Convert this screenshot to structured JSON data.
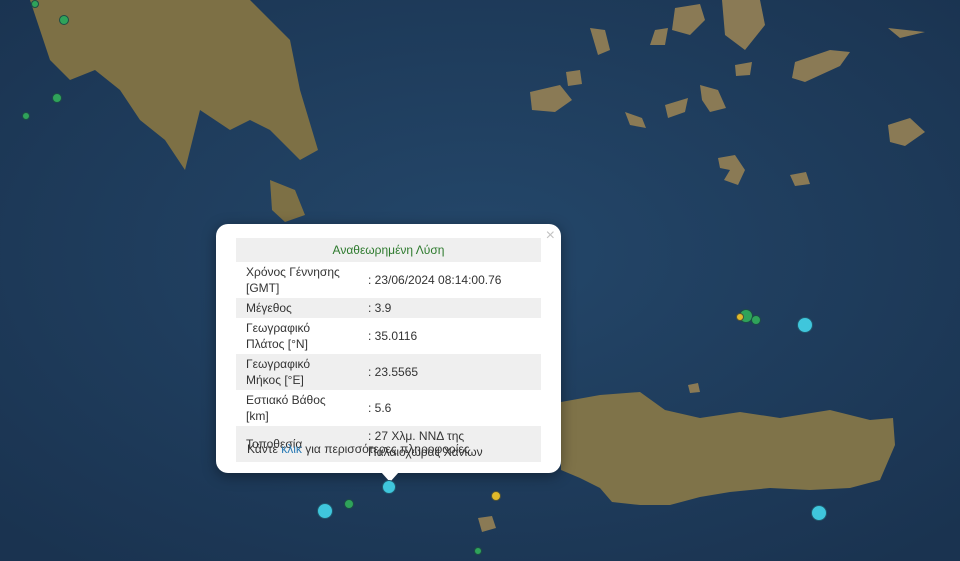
{
  "popup": {
    "title": "Αναθεωρημένη Λύση",
    "close_label": "×",
    "rows": [
      {
        "label": "Χρόνος Γέννησης [GMT]",
        "value": ": 23/06/2024 08:14:00.76"
      },
      {
        "label": "Μέγεθος",
        "value": ": 3.9"
      },
      {
        "label": "Γεωγραφικό Πλάτος [°N]",
        "value": ": 35.0116"
      },
      {
        "label": "Γεωγραφικό Μήκος [°E]",
        "value": ": 23.5565"
      },
      {
        "label": "Εστιακό Βάθος [km]",
        "value": ": 5.6"
      },
      {
        "label": "Τοποθεσία",
        "value": ": 27 Χλμ. ΝΝΔ της Παλαιοχώρας Χανίων"
      }
    ],
    "footer_pre": "Κάντε",
    "footer_link": "κλικ",
    "footer_post": "για περισσότερες πληροφορίες"
  },
  "colors": {
    "sea": "#1f3c5b",
    "land": "#8c7b52",
    "marker_cyan": "#3fc6dc",
    "marker_green": "#2fa35a",
    "marker_yellow": "#e0b92a",
    "heading_green": "#2d7a2d",
    "link": "#2a7bb5"
  },
  "markers": [
    {
      "name": "earthquake-marker-selected",
      "color": "cyan"
    },
    {
      "name": "earthquake-marker",
      "color": "cyan"
    },
    {
      "name": "earthquake-marker",
      "color": "cyan"
    },
    {
      "name": "earthquake-marker",
      "color": "cyan"
    },
    {
      "name": "earthquake-marker",
      "color": "green"
    },
    {
      "name": "earthquake-marker",
      "color": "green"
    },
    {
      "name": "earthquake-marker",
      "color": "yellow"
    }
  ]
}
